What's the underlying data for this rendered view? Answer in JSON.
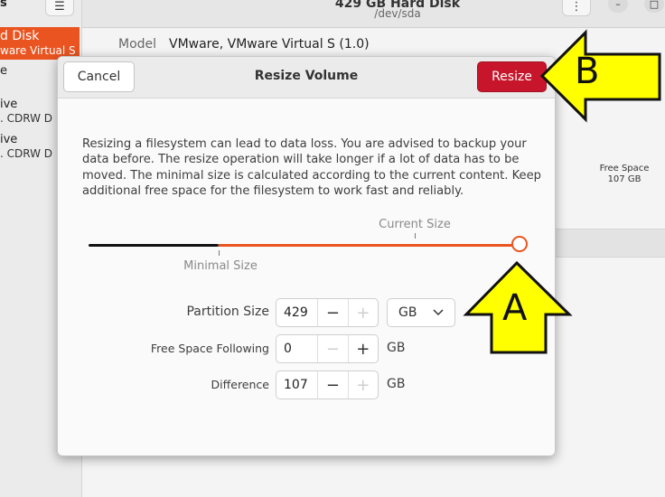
{
  "background": {
    "header": {
      "title": "429 GB Hard Disk",
      "subtitle": "/dev/sda",
      "menu_icon": "hamburger-icon",
      "more_icon": "vertical-dots-icon",
      "minimize_icon": "minimize-icon",
      "close_icon": "close-icon",
      "left_fragment": "s"
    },
    "sidebar": {
      "selected": {
        "label": "d Disk",
        "sublabel": "ware Virtual S"
      },
      "items": [
        {
          "label": "e"
        },
        {
          "label": "ive",
          "sublabel": ". CDRW D"
        },
        {
          "label": "ive",
          "sublabel": ". CDRW D"
        }
      ]
    },
    "details": {
      "model_label": "Model",
      "model_value": "VMware, VMware Virtual S (1.0)",
      "free_space_label": "Free Space",
      "free_space_value": "107 GB"
    }
  },
  "dialog": {
    "title": "Resize Volume",
    "cancel_label": "Cancel",
    "resize_label": "Resize",
    "description": "Resizing a filesystem can lead to data loss. You are advised to backup your data before. The resize operation will take longer if a lot of data has to be moved. The minimal size is calculated according to the current content. Keep additional free space for the filesystem to work fast and reliably.",
    "slider": {
      "current_size_label": "Current Size",
      "minimal_size_label": "Minimal Size",
      "min_fraction": 0.3,
      "current_fraction": 1.0
    },
    "partition_size": {
      "label": "Partition Size",
      "value": "429",
      "unit": "GB",
      "minus": "−",
      "plus": "+"
    },
    "free_space_following": {
      "label": "Free Space Following",
      "value": "0",
      "unit": "GB",
      "minus": "−",
      "plus": "+"
    },
    "difference": {
      "label": "Difference",
      "value": "107",
      "unit": "GB",
      "minus": "−",
      "plus": "+"
    }
  },
  "annotations": {
    "arrow_a": {
      "letter": "A",
      "color": "#ffff00"
    },
    "arrow_b": {
      "letter": "B",
      "color": "#ffff00"
    }
  }
}
